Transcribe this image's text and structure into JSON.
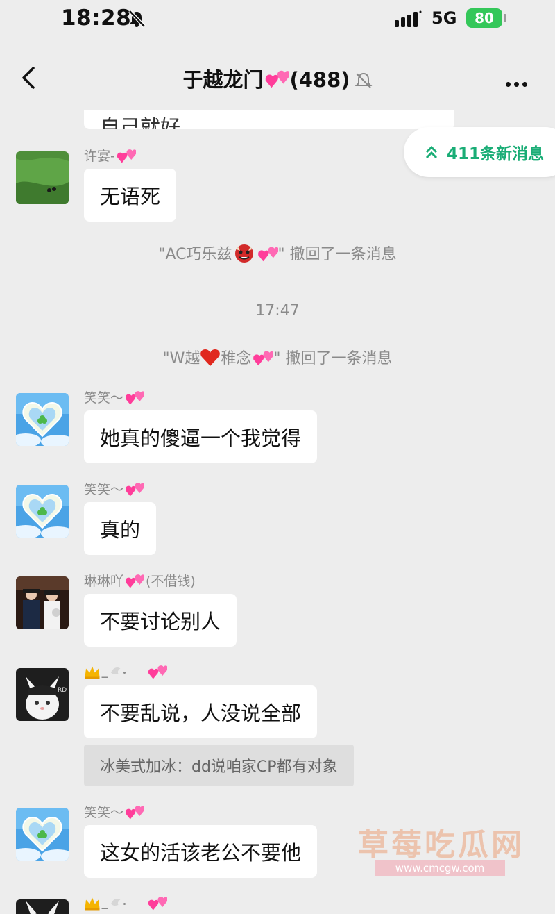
{
  "status": {
    "time": "18:28",
    "network": "5G",
    "battery": "80"
  },
  "header": {
    "title": "于越龙门",
    "count": "(488)"
  },
  "top_message_partial": "自己就好",
  "new_messages": "411条新消息",
  "messages": [
    {
      "sender": "许宴-",
      "text": "无语死"
    },
    {
      "sender": "笑笑～",
      "text": "她真的傻逼一个我觉得"
    },
    {
      "sender": "笑笑～",
      "text": "真的"
    },
    {
      "sender": "琳琳吖",
      "sender_note": "(不借钱)",
      "text": "不要讨论别人"
    },
    {
      "sender": "_",
      "text": "不要乱说，人没说全部",
      "quote": "冰美式加冰：dd说咱家CP都有对象"
    },
    {
      "sender": "笑笑～",
      "text": "这女的活该老公不要他"
    },
    {
      "sender": "_"
    }
  ],
  "system": {
    "recall1_prefix": "\"AC巧乐兹",
    "recall1_suffix": "\" 撤回了一条消息",
    "time_divider": "17:47",
    "recall2_prefix": "\"W越",
    "recall2_mid": "稚念",
    "recall2_suffix": "\" 撤回了一条消息"
  },
  "watermark": {
    "text": "草莓吃瓜网",
    "url": "www.cmcgw.com"
  },
  "colors": {
    "accent": "#1aad76",
    "background": "#ededed",
    "bubble": "#ffffff",
    "heart": "#ff4fa3",
    "battery": "#34c759"
  }
}
